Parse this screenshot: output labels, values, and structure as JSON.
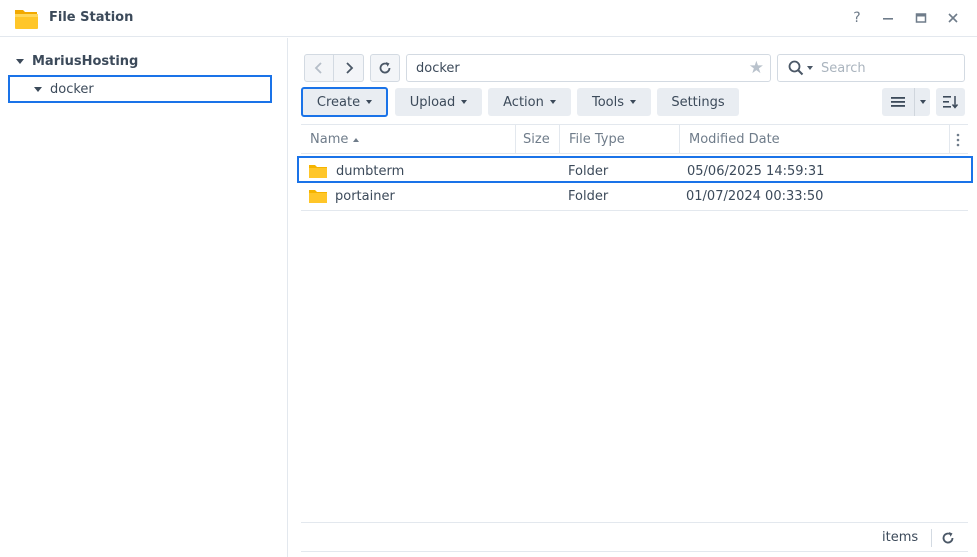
{
  "window": {
    "title": "File Station",
    "help_glyph": "?",
    "icon": "folder-app-icon",
    "accent": "#1a73e8"
  },
  "tree": {
    "root_label": "MariusHosting",
    "child_label": "docker"
  },
  "toolbar": {
    "path_value": "docker",
    "search_placeholder": "Search",
    "create_label": "Create",
    "upload_label": "Upload",
    "action_label": "Action",
    "tools_label": "Tools",
    "settings_label": "Settings"
  },
  "grid": {
    "columns": {
      "name": "Name",
      "size": "Size",
      "type": "File Type",
      "date": "Modified Date"
    },
    "rows": [
      {
        "name": "dumbterm",
        "size": "",
        "type": "Folder",
        "date": "05/06/2025 14:59:31",
        "selected": true
      },
      {
        "name": "portainer",
        "size": "",
        "type": "Folder",
        "date": "01/07/2024 00:33:50",
        "selected": false
      }
    ]
  },
  "status": {
    "items_label": "items"
  }
}
